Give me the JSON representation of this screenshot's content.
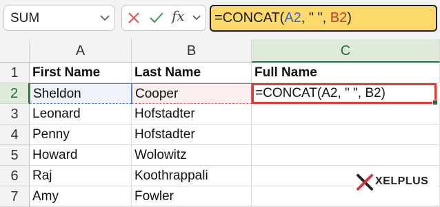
{
  "name_box": {
    "value": "SUM"
  },
  "formula_bar": {
    "fx_label": "fx",
    "formula_parts": {
      "prefix": "=CONCAT(",
      "ref1": "A2",
      "middle": ", \" \", ",
      "ref2": "B2",
      "suffix": ")"
    }
  },
  "columns": [
    "A",
    "B",
    "C"
  ],
  "rows": [
    {
      "num": "1",
      "cells": [
        "First Name",
        "Last Name",
        "Full Name"
      ]
    },
    {
      "num": "2",
      "cells": [
        "Sheldon",
        "Cooper",
        "=CONCAT(A2, \" \", B2)"
      ]
    },
    {
      "num": "3",
      "cells": [
        "Leonard",
        "Hofstadter",
        ""
      ]
    },
    {
      "num": "4",
      "cells": [
        "Penny",
        "Hofstadter",
        ""
      ]
    },
    {
      "num": "5",
      "cells": [
        "Howard",
        "Wolowitz",
        ""
      ]
    },
    {
      "num": "6",
      "cells": [
        "Raj",
        "Koothrappali",
        ""
      ]
    },
    {
      "num": "7",
      "cells": [
        "Amy",
        "Fowler",
        ""
      ]
    }
  ],
  "logo": {
    "text": "XELPLUS"
  },
  "colors": {
    "formula_highlight": "#fcd96a",
    "active_header": "#217346",
    "ref_a": "#3c63c8",
    "ref_b": "#c0392b",
    "selection_border": "#e03a35"
  }
}
